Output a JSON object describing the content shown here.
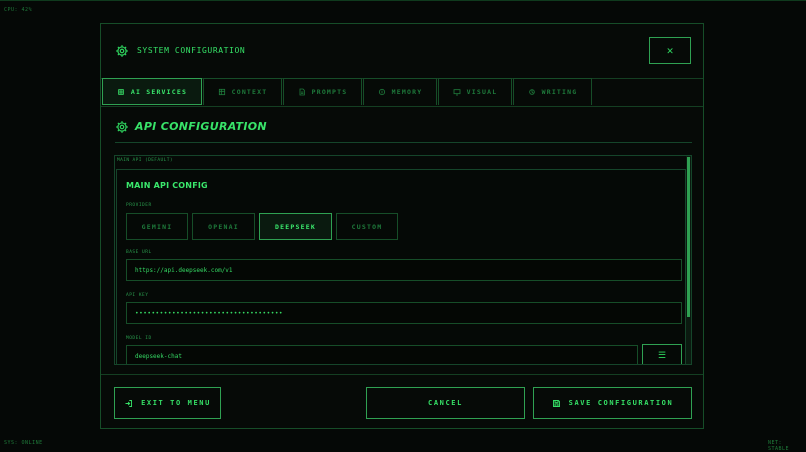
{
  "status": {
    "cpu": "CPU: 42%",
    "sys": "SYS: ONLINE",
    "net": "NET: STABLE"
  },
  "dialog": {
    "title": "SYSTEM CONFIGURATION",
    "close_glyph": "✕"
  },
  "tabs": [
    {
      "label": "AI SERVICES",
      "icon": "cpu-icon",
      "active": true
    },
    {
      "label": "CONTEXT",
      "icon": "layers-icon",
      "active": false
    },
    {
      "label": "PROMPTS",
      "icon": "file-text-icon",
      "active": false
    },
    {
      "label": "MEMORY",
      "icon": "memory-icon",
      "active": false
    },
    {
      "label": "VISUAL",
      "icon": "monitor-icon",
      "active": false
    },
    {
      "label": "WRITING",
      "icon": "pen-icon",
      "active": false
    }
  ],
  "section": {
    "title": "API CONFIGURATION"
  },
  "main_api": {
    "label": "MAIN API (DEFAULT)",
    "card_title": "MAIN API CONFIG",
    "provider_label": "PROVIDER",
    "providers": [
      "GEMINI",
      "OPENAI",
      "DEEPSEEK",
      "CUSTOM"
    ],
    "selected_provider": "DEEPSEEK",
    "base_url_label": "BASE URL",
    "base_url_value": "https://api.deepseek.com/v1",
    "api_key_label": "API KEY",
    "api_key_value": "••••••••••••••••••••••••••••••••••••",
    "model_id_label": "MODEL ID",
    "model_id_value": "deepseek-chat",
    "list_glyph": "☰"
  },
  "footer": {
    "exit_label": "EXIT TO MENU",
    "cancel_label": "CANCEL",
    "save_label": "SAVE CONFIGURATION"
  },
  "colors": {
    "accent": "#2fd65f",
    "border": "#164d28",
    "background": "#050806"
  }
}
